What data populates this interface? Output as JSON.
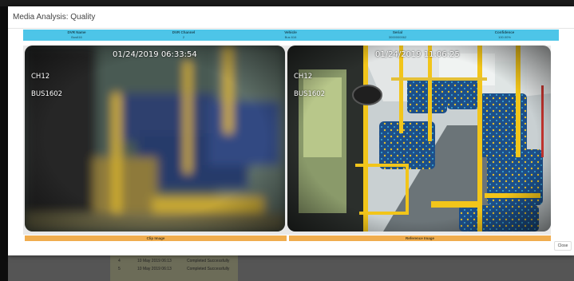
{
  "modal": {
    "title": "Media Analysis: Quality",
    "close_label": "Close"
  },
  "info": {
    "columns": [
      {
        "label": "DVR Name",
        "value": "Bus616"
      },
      {
        "label": "DVR Channel",
        "value": "2"
      },
      {
        "label": "Vehicle",
        "value": "Bus 616"
      },
      {
        "label": "Serial",
        "value": "3000000062"
      },
      {
        "label": "Confidence",
        "value": "100.00%"
      }
    ]
  },
  "clip": {
    "timestamp": "01/24/2019 06:33:54",
    "channel": "CH12",
    "bus": "BUS1602",
    "caption": "Clip Image"
  },
  "reference": {
    "timestamp": "01/24/2019 11:06:25",
    "channel": "CH12",
    "bus": "BUS1602",
    "caption": "Reference Image"
  },
  "background_table": {
    "rows": [
      {
        "index": "4",
        "date": "10 May 2019 06:13",
        "status": "Completed Successfully"
      },
      {
        "index": "5",
        "date": "10 May 2019 06:13",
        "status": "Completed Successfully"
      }
    ]
  },
  "colors": {
    "info_header": "#4dc5e8",
    "caption_bar": "#f0ad4e",
    "pole_yellow": "#f2c51a",
    "seat_blue": "#1c4f8a"
  }
}
